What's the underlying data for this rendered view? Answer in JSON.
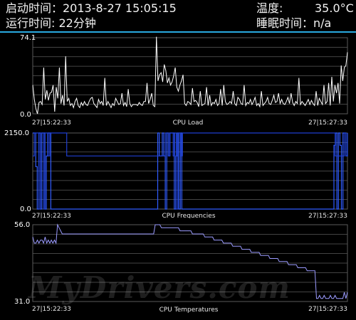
{
  "header": {
    "start_time": "启动时间：2013-8-27 15:05:15",
    "temp_label": "温度:",
    "temp_value": "35.0°C",
    "run_time": "运行时间:   22分钟",
    "sleep_time": "睡眠时间：n/a"
  },
  "colors": {
    "accent": "#29a9e0",
    "grid": "#5a5a5a",
    "load_line": "#ffffff",
    "freq_line": "#2f5bff",
    "temp_line": "#9b9bff"
  },
  "watermark": "MyDrivers.com",
  "graphs": {
    "load": {
      "title": "CPU Load",
      "y_max": "74.1",
      "y_min": "0.0",
      "x_start": "27|15:22:33",
      "x_end": "27|15:27:33"
    },
    "freq": {
      "title": "CPU Frequencies",
      "y_max": "2150.0",
      "y_min": "0.0",
      "x_start": "27|15:22:33",
      "x_end": "27|15:27:33"
    },
    "temp": {
      "title": "CPU Temperatures",
      "y_max": "56.0",
      "y_min": "31.0",
      "x_start": "27|15:22:33",
      "x_end": "27|15:27:33"
    }
  },
  "chart_data": [
    {
      "type": "line",
      "title": "CPU Load",
      "ylim": [
        0,
        74.1
      ],
      "x_start": "27|15:22:33",
      "x_end": "27|15:27:33",
      "values": [
        28,
        14,
        5,
        0,
        11,
        12,
        9,
        45,
        14,
        23,
        13,
        20,
        21,
        28,
        2,
        26,
        15,
        45,
        10,
        18,
        8,
        56,
        12,
        15,
        8,
        10,
        6,
        12,
        15,
        8,
        6,
        11,
        8,
        12,
        9,
        8,
        12,
        15,
        16,
        10,
        8,
        6,
        14,
        10,
        12,
        8,
        35,
        8,
        12,
        9,
        6,
        10,
        8,
        15,
        12,
        9,
        10,
        20,
        8,
        11,
        7,
        24,
        10,
        7,
        9,
        9,
        9,
        8,
        11,
        9,
        8,
        12,
        12,
        30,
        10,
        14,
        20,
        8,
        7,
        75,
        32,
        38,
        40,
        31,
        48,
        42,
        30,
        35,
        28,
        31,
        37,
        45,
        26,
        22,
        28,
        32,
        38,
        10,
        8,
        12,
        11,
        9,
        25,
        12,
        13,
        11,
        7,
        22,
        8,
        9,
        10,
        26,
        8,
        18,
        8,
        11,
        10,
        14,
        8,
        10,
        24,
        8,
        28,
        12,
        9,
        10,
        12,
        10,
        22,
        10,
        8,
        16,
        14,
        10,
        9,
        28,
        8,
        11,
        10,
        14,
        9,
        12,
        16,
        8,
        10,
        7,
        22,
        8,
        10,
        12,
        16,
        10,
        9,
        13,
        18,
        11,
        12,
        20,
        10,
        14,
        10,
        9,
        12,
        16,
        10,
        20,
        11,
        8,
        12,
        10,
        35,
        9,
        12,
        10,
        8,
        11,
        14,
        9,
        13,
        10,
        8,
        22,
        8,
        15,
        12,
        9,
        28,
        10,
        12,
        30,
        8,
        36,
        12,
        28,
        20,
        30,
        10,
        47,
        32,
        45,
        47,
        60
      ]
    },
    {
      "type": "line",
      "title": "CPU Frequencies",
      "ylim": [
        0,
        2150
      ],
      "x_start": "27|15:22:33",
      "x_end": "27|15:27:33",
      "series": [
        {
          "values": [
            2150,
            2150,
            1200,
            0,
            2150,
            0,
            2150,
            2150,
            0,
            1500,
            2150,
            2150,
            0,
            0,
            0,
            0,
            0,
            0,
            0,
            0,
            0,
            0,
            0,
            0,
            0,
            0,
            0,
            0,
            0,
            0,
            0,
            0,
            0,
            0,
            0,
            0,
            0,
            0,
            0,
            0,
            0,
            0,
            0,
            0,
            0,
            0,
            0,
            0,
            0,
            0,
            0,
            0,
            0,
            0,
            0,
            0,
            0,
            0,
            0,
            0,
            0,
            0,
            0,
            0,
            0,
            0,
            0,
            0,
            0,
            0,
            0,
            0,
            0,
            0,
            0,
            0,
            0,
            0,
            0,
            0,
            0,
            0,
            0,
            2150,
            1500,
            1500,
            2150,
            1500,
            0,
            2150,
            1500,
            2150,
            2150,
            2150,
            0,
            1500,
            2150,
            0,
            2150,
            0,
            0,
            0,
            0,
            0,
            0,
            0,
            0,
            0,
            0,
            0,
            0,
            0,
            0,
            0,
            0,
            0,
            0,
            0,
            0,
            0,
            0,
            0,
            0,
            0,
            0,
            0,
            0,
            0,
            0,
            0,
            0,
            0,
            0,
            0,
            0,
            0,
            0,
            0,
            0,
            0,
            0,
            0,
            0,
            0,
            0,
            0,
            0,
            0,
            0,
            0,
            0,
            0,
            0,
            0,
            0,
            0,
            0,
            0,
            0,
            0,
            0,
            0,
            0,
            0,
            0,
            0,
            0,
            0,
            0,
            0,
            0,
            0,
            0,
            0,
            0,
            0,
            0,
            0,
            0,
            0,
            0,
            0,
            0,
            0,
            0,
            0,
            0,
            0,
            0,
            0,
            0,
            0,
            0,
            0,
            0,
            0,
            0,
            0,
            0,
            0,
            1800,
            2150,
            0,
            2150,
            1800,
            0,
            2150,
            2150,
            1500,
            2150
          ]
        },
        {
          "values": [
            1500,
            2150,
            2150,
            2150,
            0,
            2150,
            2150,
            0,
            2150,
            2150,
            1500,
            2150,
            2150,
            2150,
            2150,
            2150,
            2150,
            2150,
            2150,
            2150,
            2150,
            2150,
            1500,
            1500,
            1500,
            1500,
            1500,
            1500,
            1500,
            1500,
            1500,
            1500,
            1500,
            1500,
            1500,
            1500,
            1500,
            1500,
            1500,
            1500,
            1500,
            1500,
            1500,
            1500,
            1500,
            1500,
            1500,
            1500,
            1500,
            1500,
            1500,
            1500,
            1500,
            1500,
            1500,
            1500,
            1500,
            1500,
            1500,
            1500,
            1500,
            1500,
            1500,
            1500,
            1500,
            1500,
            1500,
            1500,
            1500,
            1500,
            1500,
            1500,
            1500,
            1500,
            1500,
            1500,
            1500,
            1500,
            1500,
            1500,
            1500,
            1500,
            1500,
            1500,
            1500,
            1500,
            2150,
            2150,
            1500,
            2150,
            2150,
            1500,
            2150,
            0,
            2150,
            2150,
            1500,
            2150,
            2150,
            2150,
            2150,
            2150,
            2150,
            2150,
            2150,
            2150,
            2150,
            2150,
            2150,
            2150,
            2150,
            2150,
            2150,
            2150,
            2150,
            2150,
            2150,
            2150,
            2150,
            2150,
            2150,
            2150,
            2150,
            2150,
            2150,
            2150,
            2150,
            2150,
            2150,
            2150,
            2150,
            2150,
            2150,
            2150,
            2150,
            2150,
            2150,
            2150,
            2150,
            2150,
            2150,
            2150,
            2150,
            2150,
            2150,
            2150,
            2150,
            2150,
            2150,
            2150,
            2150,
            2150,
            2150,
            2150,
            2150,
            2150,
            2150,
            2150,
            2150,
            2150,
            2150,
            2150,
            2150,
            2150,
            2150,
            2150,
            2150,
            2150,
            2150,
            2150,
            2150,
            2150,
            2150,
            2150,
            2150,
            2150,
            2150,
            2150,
            2150,
            2150,
            2150,
            2150,
            2150,
            2150,
            2150,
            2150,
            2150,
            2150,
            2150,
            2150,
            2150,
            2150,
            2150,
            2150,
            2150,
            2150,
            1500,
            1500,
            1500,
            1500,
            1500,
            1500,
            2150,
            1500,
            1500
          ]
        }
      ]
    },
    {
      "type": "line",
      "title": "CPU Temperatures",
      "ylim": [
        31,
        56
      ],
      "x_start": "27|15:22:33",
      "x_end": "27|15:27:33",
      "values": [
        52,
        50,
        50,
        51,
        50,
        51,
        51,
        50,
        52,
        50,
        51,
        50,
        51,
        50,
        51,
        50,
        56,
        55,
        54,
        53,
        53,
        53,
        53,
        53,
        53,
        53,
        53,
        53,
        53,
        53,
        53,
        53,
        53,
        53,
        53,
        53,
        53,
        53,
        53,
        53,
        53,
        53,
        53,
        53,
        53,
        53,
        53,
        53,
        53,
        53,
        53,
        53,
        53,
        53,
        53,
        53,
        53,
        53,
        53,
        53,
        53,
        53,
        53,
        53,
        53,
        53,
        53,
        53,
        53,
        53,
        53,
        53,
        53,
        53,
        53,
        53,
        53,
        53,
        53,
        56,
        56,
        56,
        56,
        55,
        55,
        55,
        55,
        55,
        55,
        55,
        55,
        55,
        55,
        55,
        55,
        54,
        54,
        54,
        54,
        54,
        54,
        54,
        54,
        53,
        53,
        53,
        53,
        53,
        53,
        53,
        53,
        52,
        52,
        52,
        52,
        52,
        52,
        51,
        51,
        51,
        51,
        51,
        51,
        50,
        50,
        50,
        50,
        50,
        50,
        49,
        49,
        49,
        49,
        49,
        49,
        48,
        48,
        48,
        48,
        48,
        48,
        47,
        47,
        47,
        47,
        47,
        47,
        46,
        46,
        46,
        46,
        46,
        46,
        45,
        45,
        45,
        45,
        45,
        45,
        44,
        44,
        44,
        44,
        44,
        44,
        43,
        43,
        43,
        43,
        43,
        43,
        42,
        42,
        42,
        42,
        42,
        42,
        41,
        41,
        41,
        41,
        41,
        41,
        32,
        32,
        33,
        32,
        32,
        33,
        32,
        32,
        32,
        33,
        32,
        32,
        33,
        32,
        32,
        32,
        32,
        32,
        34,
        32,
        34
      ]
    }
  ]
}
